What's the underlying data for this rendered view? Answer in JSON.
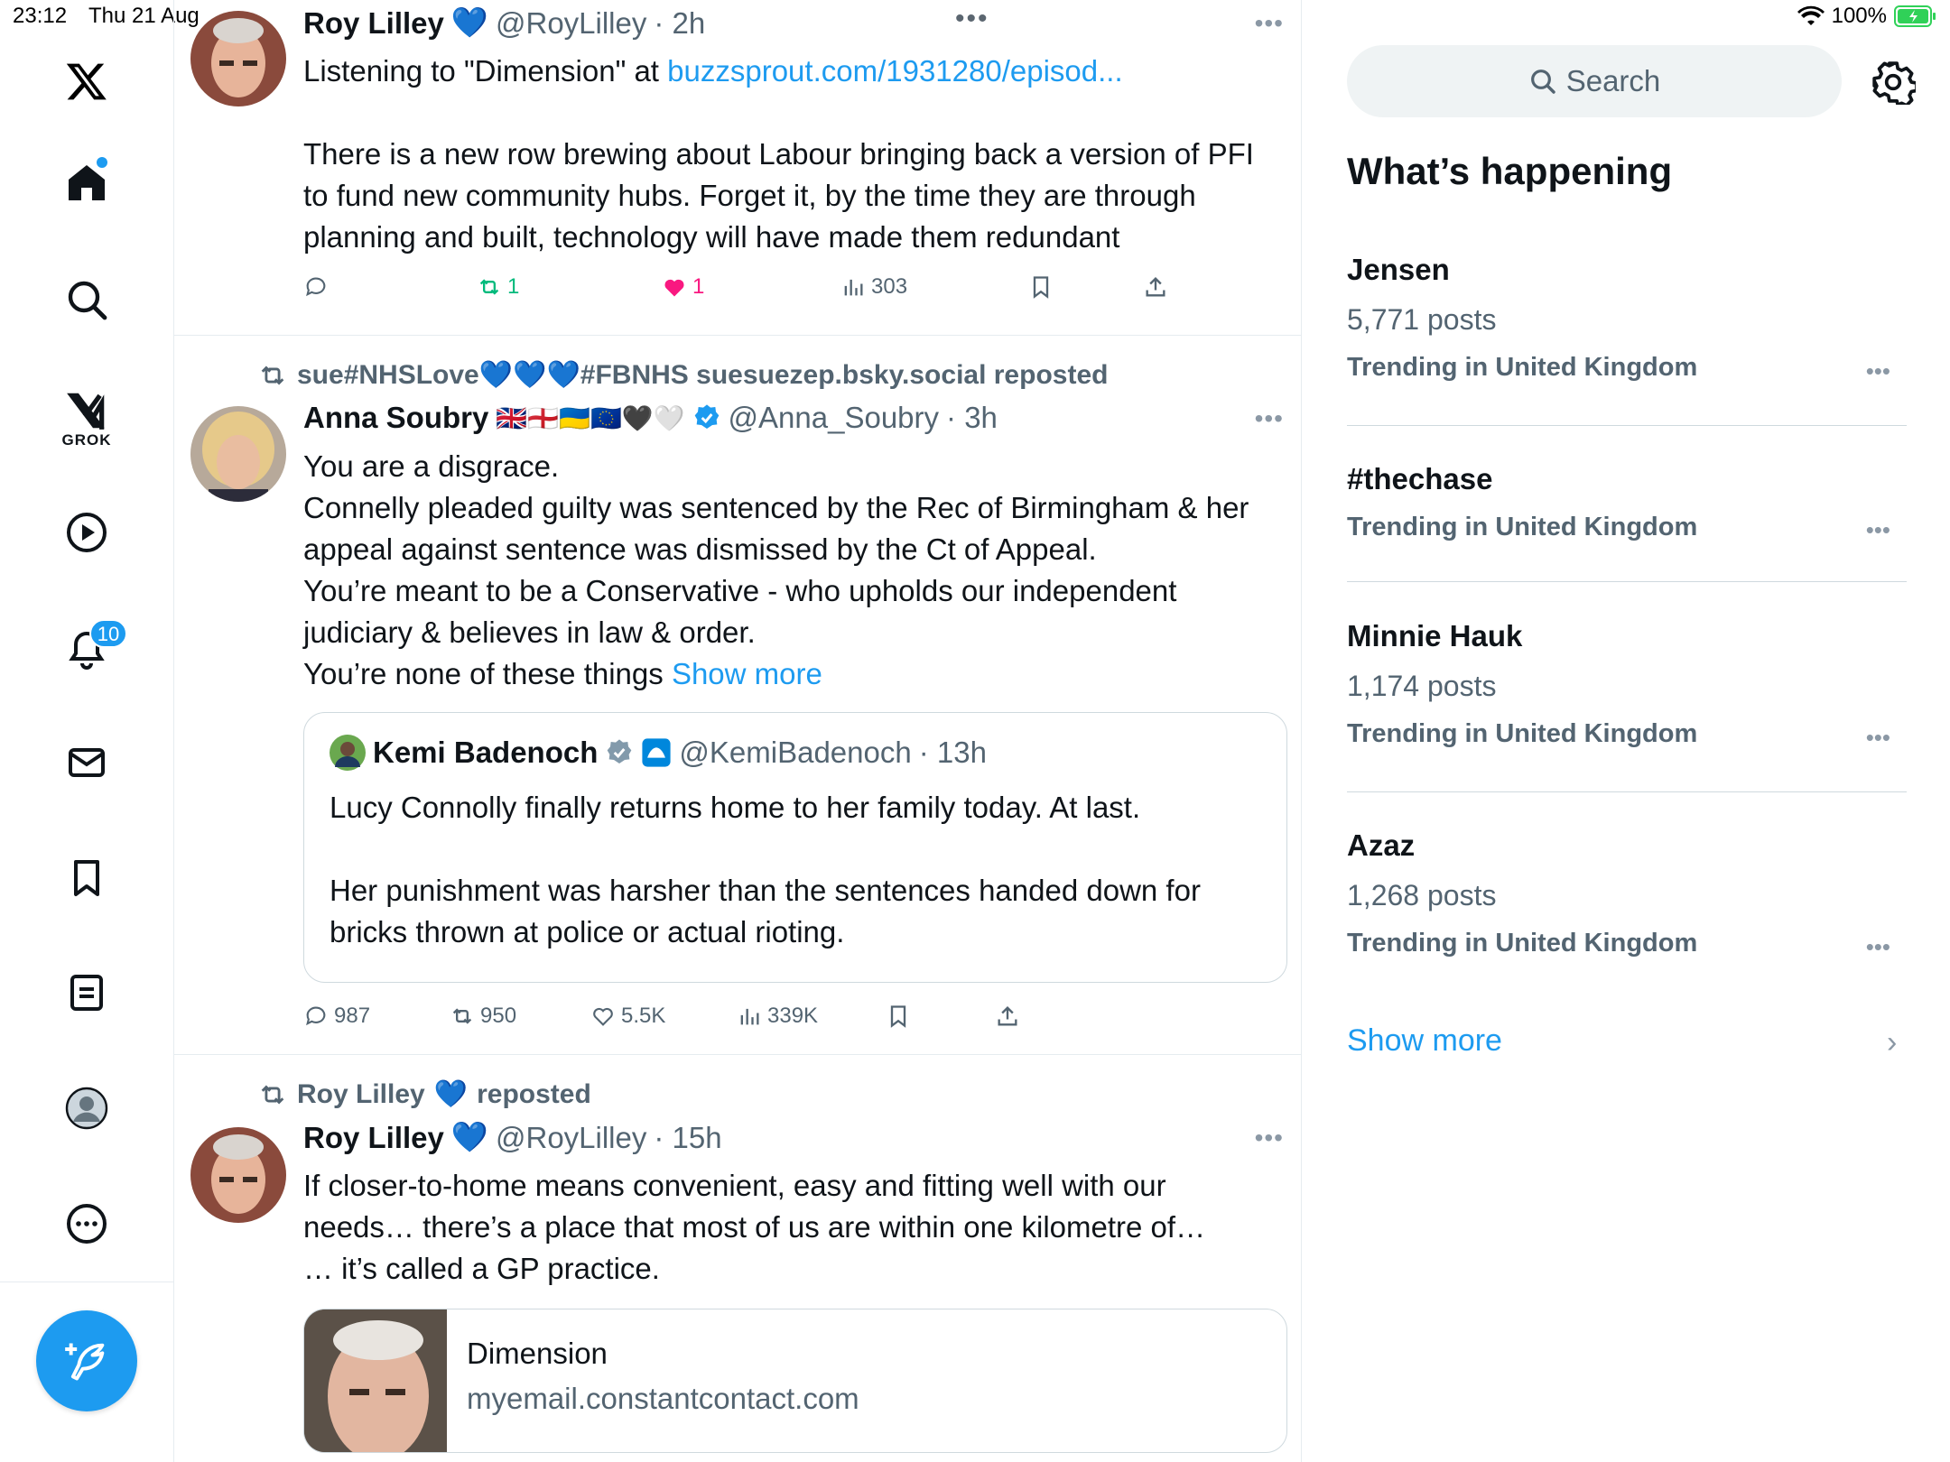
{
  "status": {
    "time": "23:12",
    "date": "Thu 21 Aug",
    "battery": "100%",
    "dots": "•••"
  },
  "nav": {
    "grok_label": "GROK",
    "notifications_count": "10"
  },
  "posts": [
    {
      "name": "Roy Lilley",
      "emoji": "💙",
      "handle": "@RoyLilley",
      "time": "· 2h",
      "body_prefix": "Listening to \"Dimension\" at ",
      "body_link": "buzzsprout.com/1931280/episod...",
      "body_rest": "There is a new row brewing about Labour bringing back a version of PFI to fund new community hubs. Forget it, by the time they are through planning and built, technology will have made them redundant",
      "reposts": "1",
      "likes": "1",
      "views": "303"
    },
    {
      "repost_by": "sue#NHSLove💙💙💙#FBNHS suesuezep.bsky.social reposted",
      "name": "Anna Soubry",
      "flags": "🇬🇧🏴󠁧󠁢󠁥󠁮󠁧󠁿🇺🇦🇪🇺🖤🤍",
      "handle": "@Anna_Soubry",
      "time": "· 3h",
      "body": "You are a disgrace.\nConnelly pleaded guilty was sentenced by the Rec of Birmingham & her appeal against sentence was dismissed by the Ct of Appeal.\nYou’re meant to be a Conservative - who upholds our independent judiciary & believes in law & order.\nYou’re none of these things ",
      "show_more": "Show more",
      "quote": {
        "name": "Kemi Badenoch",
        "handle": "@KemiBadenoch",
        "time": "· 13h",
        "body": "Lucy Connolly finally returns home to her family today. At last.\n\nHer punishment was harsher than the sentences handed down for bricks thrown at police or actual rioting."
      },
      "replies": "987",
      "reposts": "950",
      "likes": "5.5K",
      "views": "339K"
    },
    {
      "repost_by_name": "Roy Lilley",
      "repost_by_emoji": "💙",
      "repost_suffix": "reposted",
      "name": "Roy Lilley",
      "emoji": "💙",
      "handle": "@RoyLilley",
      "time": "· 15h",
      "body": "If closer-to-home means convenient, easy and fitting well with our needs… there’s a place that most of us are within one kilometre of…\n… it’s called a GP practice.",
      "card": {
        "title": "Dimension",
        "domain": "myemail.constantcontact.com"
      }
    }
  ],
  "sidebar": {
    "search_placeholder": "Search",
    "heading": "What’s happening",
    "trends": [
      {
        "title": "Jensen",
        "count": "5,771 posts",
        "location": "Trending in United Kingdom"
      },
      {
        "title": "#thechase",
        "count": "",
        "location": "Trending in United Kingdom"
      },
      {
        "title": "Minnie Hauk",
        "count": "1,174 posts",
        "location": "Trending in United Kingdom"
      },
      {
        "title": "Azaz",
        "count": "1,268 posts",
        "location": "Trending in United Kingdom"
      }
    ],
    "show_more": "Show more"
  },
  "colors": {
    "accent": "#1d9bf0",
    "like": "#f91880",
    "repost": "#00ba7c",
    "muted": "#536471"
  }
}
